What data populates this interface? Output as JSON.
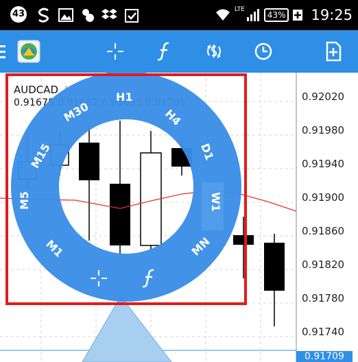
{
  "status_bar": {
    "notification_count": "43",
    "network": "LTE",
    "battery": "43%",
    "time": "19:25"
  },
  "toolbar": {
    "icons": [
      "menu-icon",
      "metatrader-logo-icon",
      "crosshair-icon",
      "function-icon",
      "trade-icon",
      "clock-icon",
      "new-document-icon"
    ]
  },
  "chart": {
    "symbol": "AUDCAD",
    "timeframe": "M5",
    "ohlc": "0.91675 0.91692 0.91693 0.91705",
    "price_labels": [
      "0.92020",
      "0.91980",
      "0.91940",
      "0.91900",
      "0.91860",
      "0.91820",
      "0.91780",
      "0.91740"
    ],
    "current_price": "0.91709"
  },
  "timeframe_dial": {
    "items": [
      "H1",
      "H4",
      "D1",
      "W1",
      "MN",
      "M1",
      "M5",
      "M15",
      "M30"
    ],
    "tools": [
      "crosshair-icon",
      "function-icon"
    ]
  },
  "colors": {
    "toolbar": "#2f8fe6",
    "dial": "#3a8fe6",
    "highlight_frame": "#e01b1b",
    "moving_average": "#e03030",
    "pointer": "#a8cff0"
  }
}
